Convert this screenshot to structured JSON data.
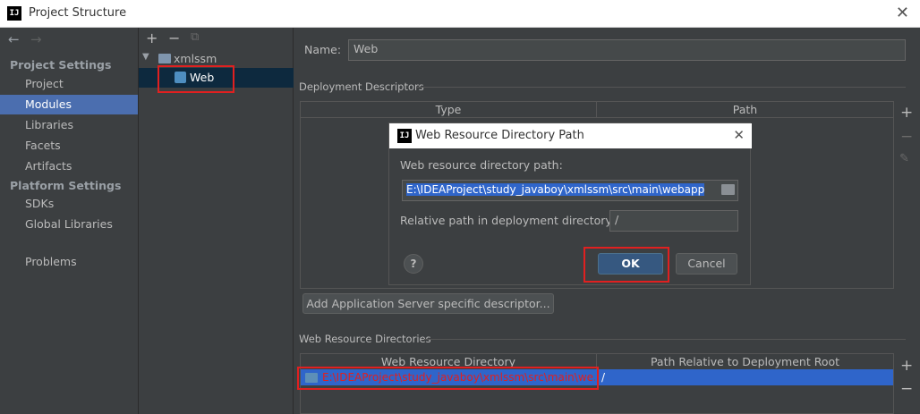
{
  "window": {
    "title": "Project Structure",
    "logo": "IJ"
  },
  "nav": {
    "back_icon": "←",
    "forward_icon": "→",
    "project_settings_header": "Project Settings",
    "project_settings": [
      "Project",
      "Modules",
      "Libraries",
      "Facets",
      "Artifacts"
    ],
    "platform_settings_header": "Platform Settings",
    "platform_settings": [
      "SDKs",
      "Global Libraries"
    ],
    "problems": "Problems",
    "selected": "Modules"
  },
  "tree": {
    "toolbar": {
      "add": "+",
      "remove": "−",
      "copy": "⧉"
    },
    "root": "xmlssm",
    "child": "Web"
  },
  "details": {
    "name_label": "Name:",
    "name_value": "Web",
    "deployment_descriptors_header": "Deployment Descriptors",
    "dd_columns": [
      "Type",
      "Path"
    ],
    "add_descriptor_button": "Add Application Server specific descriptor...",
    "web_resource_dirs_header": "Web Resource Directories",
    "wrd_columns": [
      "Web Resource Directory",
      "Path Relative to Deployment Root"
    ],
    "wrd_row": {
      "directory": "E:\\IDEAProject\\study_javaboy\\xmlssm\\src\\main\\we...",
      "relative": "/"
    },
    "side_add": "+",
    "side_remove": "−",
    "side_edit": "✎"
  },
  "dialog": {
    "logo": "IJ",
    "title": "Web Resource Directory Path",
    "path_label": "Web resource directory path:",
    "path_value": "E:\\IDEAProject\\study_javaboy\\xmlssm\\src\\main\\webapp",
    "relative_label": "Relative path in deployment directory:",
    "relative_value": "/",
    "help": "?",
    "ok": "OK",
    "cancel": "Cancel",
    "close": "✕"
  },
  "colors": {
    "accent": "#4b6eaf",
    "highlight": "#e02020",
    "ok_button": "#365880",
    "selection": "#2f65ca"
  }
}
